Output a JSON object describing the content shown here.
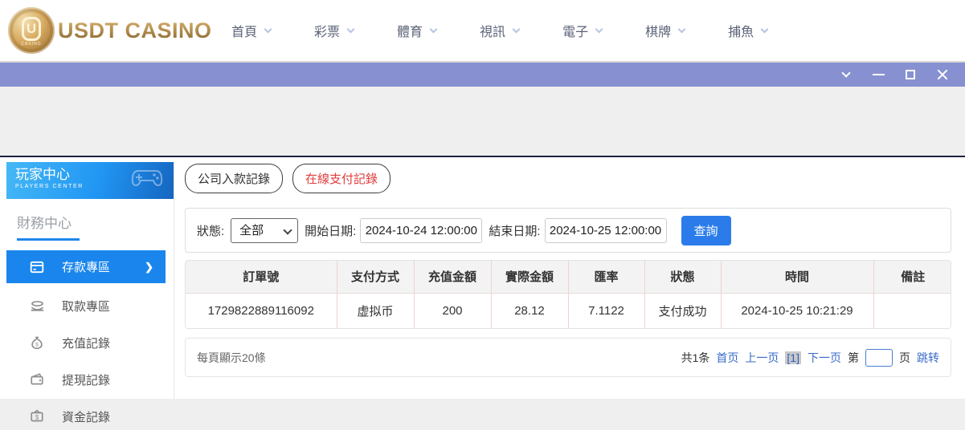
{
  "header": {
    "logo_text": "USDT CASINO",
    "logo_badge_letter": "U",
    "logo_badge_sub": "CASINO",
    "nav": [
      {
        "label": "首頁"
      },
      {
        "label": "彩票"
      },
      {
        "label": "體育"
      },
      {
        "label": "視訊"
      },
      {
        "label": "電子"
      },
      {
        "label": "棋牌"
      },
      {
        "label": "捕魚"
      }
    ]
  },
  "titlebar": {
    "controls": [
      "chevron-down-icon",
      "minimize-icon",
      "maximize-icon",
      "close-icon"
    ],
    "bg_color": "#8791d1"
  },
  "sidebar": {
    "title": "玩家中心",
    "subtitle": "PLAYERS CENTER",
    "section_title": "財務中心",
    "active_color": "#1a86ed",
    "items": [
      {
        "label": "存款專區",
        "icon": "deposit-card-icon",
        "active": true
      },
      {
        "label": "取款專區",
        "icon": "withdraw-hand-icon",
        "active": false
      },
      {
        "label": "充值記錄",
        "icon": "recharge-moneybag-icon",
        "active": false
      },
      {
        "label": "提現記錄",
        "icon": "withdraw-wallet-icon",
        "active": false
      },
      {
        "label": "資金記錄",
        "icon": "funds-moneybag-icon",
        "active": false
      }
    ]
  },
  "main": {
    "tabs": [
      {
        "label": "公司入款記錄",
        "text_color": "#333333"
      },
      {
        "label": "在線支付記錄",
        "text_color": "#e23c3c"
      }
    ],
    "filters": {
      "status_label": "狀態:",
      "status_value": "全部",
      "start_label": "開始日期:",
      "start_value": "2024-10-24 12:00:00",
      "end_label": "結束日期:",
      "end_value": "2024-10-25 12:00:00",
      "search_button": "查詢",
      "search_button_color": "#2b7cea"
    },
    "table": {
      "headers": [
        "訂單號",
        "支付方式",
        "充值金額",
        "實際金額",
        "匯率",
        "狀態",
        "時間",
        "備註"
      ],
      "rows": [
        {
          "order_no": "1729822889116092",
          "pay_method": "虚拟币",
          "recharge_amount": "200",
          "actual_amount": "28.12",
          "rate": "7.1122",
          "status": "支付成功",
          "time": "2024-10-25 10:21:29",
          "remark": ""
        }
      ]
    },
    "pagination": {
      "per_page_text": "每頁顯示20條",
      "total_text": "共1条",
      "first": "首页",
      "prev": "上一页",
      "current": "[1]",
      "next": "下一页",
      "jump_prefix": "第",
      "jump_suffix": "页",
      "jump_button": "跳转",
      "link_color": "#3a6bc8"
    }
  }
}
